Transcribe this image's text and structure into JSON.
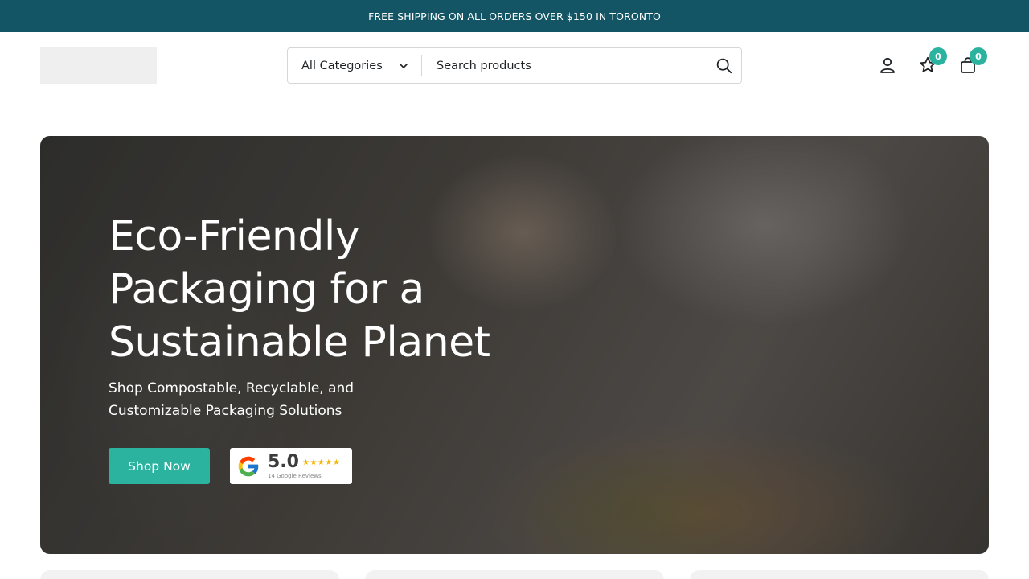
{
  "announcement": {
    "text": "FREE SHIPPING ON ALL ORDERS OVER $150 IN TORONTO"
  },
  "header": {
    "category_select": {
      "label": "All Categories"
    },
    "search": {
      "placeholder": "Search products"
    },
    "wishlist": {
      "count": "0"
    },
    "cart": {
      "count": "0"
    }
  },
  "hero": {
    "title": "Eco-Friendly Packaging for a Sustainable Planet",
    "subtitle": "Shop Compostable, Recyclable, and Customizable Packaging Solutions",
    "cta_label": "Shop Now",
    "google_rating": {
      "score": "5.0",
      "stars": "★★★★★",
      "reviews_text": "14 Google Reviews"
    }
  },
  "colors": {
    "topbar": "#135564",
    "accent": "#2bb3a0"
  },
  "icons": [
    "user-icon",
    "star-icon",
    "bag-icon",
    "search-icon",
    "chevron-down-icon",
    "google-icon"
  ]
}
